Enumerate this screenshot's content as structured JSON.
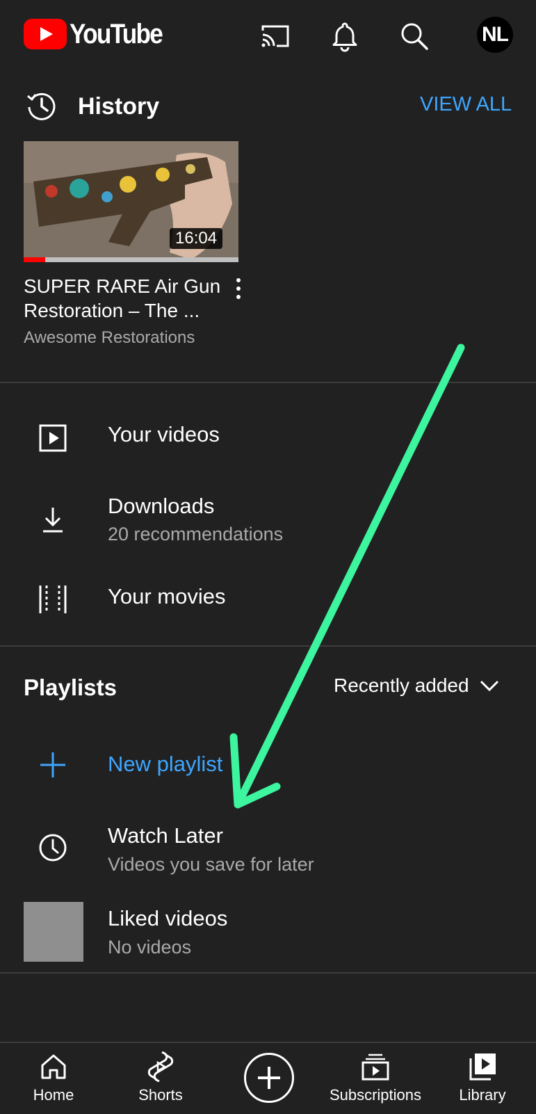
{
  "header": {
    "logo_text": "YouTube",
    "avatar_initials": "NL",
    "icons": [
      "cast-icon",
      "bell-icon",
      "search-icon"
    ]
  },
  "history": {
    "title": "History",
    "view_all": "VIEW ALL",
    "video": {
      "title_line1": "SUPER RARE Air Gun",
      "title_line2": "Restoration – The ...",
      "channel": "Awesome Restorations",
      "duration": "16:04",
      "watched_fraction": 0.1
    }
  },
  "library_items": {
    "your_videos": "Your videos",
    "downloads": "Downloads",
    "downloads_sub": "20 recommendations",
    "your_movies": "Your movies"
  },
  "playlists": {
    "title": "Playlists",
    "sort_label": "Recently added",
    "new_playlist": "New playlist",
    "watch_later": "Watch Later",
    "watch_later_sub": "Videos you save for later",
    "liked_videos": "Liked videos",
    "liked_videos_sub": "No videos"
  },
  "bottom_nav": {
    "home": "Home",
    "shorts": "Shorts",
    "subscriptions": "Subscriptions",
    "library": "Library"
  },
  "colors": {
    "background": "#212121",
    "accent_blue": "#3ea6ff",
    "youtube_red": "#ff0000",
    "annotation_green": "#3cf59e"
  }
}
